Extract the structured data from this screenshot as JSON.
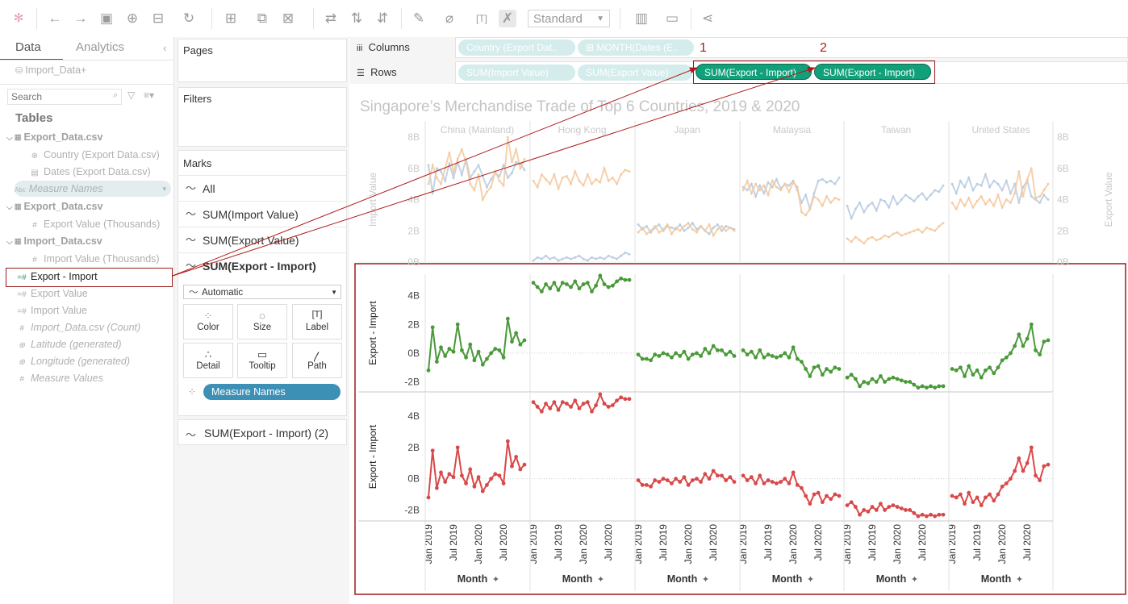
{
  "toolbar": {
    "fit_label": "Standard"
  },
  "data_pane": {
    "tabs": [
      "Data",
      "Analytics"
    ],
    "datasource": "Import_Data+",
    "search_placeholder": "Search",
    "tables_header": "Tables",
    "items": [
      {
        "label": "Export_Data.csv",
        "kind": "table",
        "icon": "table-icon"
      },
      {
        "label": "Country (Export Data.csv)",
        "kind": "dim",
        "icon": "globe-icon"
      },
      {
        "label": "Dates (Export Data.csv)",
        "kind": "dim",
        "icon": "calendar-icon"
      },
      {
        "label": "Measure Names",
        "kind": "pill",
        "icon": "abc-icon"
      },
      {
        "label": "Export_Data.csv",
        "kind": "table",
        "icon": "table-icon"
      },
      {
        "label": "Export Value (Thousands)",
        "kind": "measure",
        "icon": "number-icon"
      },
      {
        "label": "Import_Data.csv",
        "kind": "table",
        "icon": "table-icon"
      },
      {
        "label": "Import Value (Thousands)",
        "kind": "measure",
        "icon": "number-icon"
      },
      {
        "label": "Export - Import",
        "kind": "selected",
        "icon": "calc-icon"
      },
      {
        "label": "Export Value",
        "kind": "measure",
        "icon": "calc-icon"
      },
      {
        "label": "Import Value",
        "kind": "measure",
        "icon": "calc-icon"
      },
      {
        "label": "Import_Data.csv (Count)",
        "kind": "italic",
        "icon": "number-icon"
      },
      {
        "label": "Latitude (generated)",
        "kind": "italic",
        "icon": "globe-icon"
      },
      {
        "label": "Longitude (generated)",
        "kind": "italic",
        "icon": "globe-icon"
      },
      {
        "label": "Measure Values",
        "kind": "italic",
        "icon": "number-icon"
      }
    ]
  },
  "shelves": {
    "pages_label": "Pages",
    "filters_label": "Filters",
    "marks_label": "Marks",
    "marks_rows": [
      "All",
      "SUM(Import Value)",
      "SUM(Export Value)",
      "SUM(Export - Import)"
    ],
    "mark_type": "Automatic",
    "mark_buttons": [
      "Color",
      "Size",
      "Label",
      "Detail",
      "Tooltip",
      "Path"
    ],
    "color_pill": "Measure Names",
    "marks_last_row": "SUM(Export - Import) (2)"
  },
  "columns_shelf": {
    "label": "Columns",
    "pills": [
      "Country (Export Dat..",
      "⊞ MONTH(Dates (E.."
    ]
  },
  "rows_shelf": {
    "label": "Rows",
    "pills": [
      "SUM(Import Value)",
      "SUM(Export Value)",
      "SUM(Export - Import)",
      "SUM(Export - Import)"
    ]
  },
  "annotations": [
    "1",
    "2"
  ],
  "chart_data": {
    "type": "line",
    "title": "Singapore’s Merchandise Trade of Top 6 Countries, 2019 & 2020",
    "categories": [
      "China (Mainland)",
      "Hong Kong",
      "Japan",
      "Malaysia",
      "Taiwan",
      "United States"
    ],
    "x_ticks": [
      "Jan 2019",
      "Jul 2019",
      "Jan 2020",
      "Jul 2020"
    ],
    "x_label": "Month",
    "rows": [
      {
        "ylabel": "Import Value",
        "ylabel_right": "Export Value",
        "ticks": [
          "8B",
          "6B",
          "4B",
          "2B",
          "0B"
        ],
        "ylim": [
          0,
          8
        ]
      },
      {
        "ylabel": "Export - Import",
        "ticks": [
          "4B",
          "2B",
          "0B",
          "-2B"
        ],
        "ylim": [
          -2.7,
          5.5
        ]
      },
      {
        "ylabel": "Export - Import",
        "ticks": [
          "4B",
          "2B",
          "0B",
          "-2B"
        ],
        "ylim": [
          -2.7,
          5.5
        ]
      }
    ],
    "series_colors": {
      "import": "#b8cbe0",
      "export": "#f5c9a0",
      "diff1": "#4a9a3a",
      "diff2": "#d9494a"
    },
    "import_series": [
      [
        6.2,
        4.4,
        6.0,
        5.8,
        5.2,
        6.3,
        5.4,
        6.4,
        5.6,
        6.6,
        5.4,
        5.8,
        6.2,
        5.5,
        4.8,
        5.3,
        5.7,
        5.5,
        6.2,
        5.4,
        5.7,
        6.4,
        6.3,
        5.9
      ],
      [
        0.1,
        0.3,
        0.2,
        0.4,
        0.2,
        0.3,
        0.1,
        0.2,
        0.3,
        0.2,
        0.3,
        0.4,
        0.2,
        0.1,
        0.3,
        0.2,
        0.3,
        0.2,
        0.4,
        0.3,
        0.2,
        0.4,
        0.6,
        0.5
      ],
      [
        2.4,
        2.1,
        2.3,
        1.9,
        2.2,
        2.4,
        2.0,
        2.3,
        2.2,
        2.1,
        2.4,
        2.0,
        2.2,
        2.5,
        2.1,
        2.3,
        2.0,
        1.8,
        2.2,
        2.4,
        2.0,
        2.3,
        2.2,
        2.1
      ],
      [
        4.8,
        4.6,
        5.0,
        4.2,
        4.9,
        4.4,
        5.1,
        4.8,
        5.3,
        4.7,
        5.0,
        4.9,
        5.2,
        4.6,
        3.8,
        4.3,
        3.4,
        4.4,
        5.2,
        5.3,
        5.1,
        5.2,
        5.0,
        5.4
      ],
      [
        3.6,
        2.8,
        3.4,
        3.8,
        3.2,
        3.6,
        3.8,
        3.3,
        4.0,
        3.9,
        3.5,
        4.2,
        3.7,
        4.0,
        4.3,
        4.1,
        3.9,
        4.2,
        4.4,
        4.0,
        4.3,
        4.6,
        4.5,
        4.9
      ],
      [
        5.0,
        4.4,
        5.2,
        4.8,
        5.4,
        4.6,
        5.0,
        4.9,
        5.6,
        4.8,
        5.2,
        5.0,
        4.6,
        5.2,
        4.4,
        5.0,
        3.8,
        4.8,
        5.2,
        4.2,
        4.0,
        3.8,
        4.3,
        4.0
      ]
    ],
    "export_series": [
      [
        5.0,
        6.2,
        5.4,
        5.0,
        6.0,
        7.0,
        5.8,
        6.6,
        7.2,
        6.4,
        5.0,
        4.6,
        5.6,
        4.0,
        4.5,
        4.8,
        5.8,
        5.2,
        4.9,
        8.0,
        6.4,
        7.2,
        6.0,
        6.6
      ],
      [
        5.2,
        4.8,
        5.6,
        5.3,
        5.0,
        5.6,
        4.7,
        5.4,
        5.5,
        5.0,
        5.8,
        5.2,
        4.9,
        5.6,
        5.0,
        5.3,
        5.1,
        6.0,
        5.2,
        5.4,
        5.0,
        5.6,
        5.9,
        5.8
      ],
      [
        1.9,
        2.2,
        1.8,
        2.0,
        2.3,
        1.9,
        2.1,
        2.4,
        1.8,
        2.2,
        2.0,
        2.3,
        2.5,
        2.1,
        1.9,
        2.3,
        2.0,
        2.4,
        1.7,
        2.1,
        2.3,
        2.0,
        2.2,
        2.0
      ],
      [
        4.6,
        5.2,
        4.4,
        5.0,
        4.6,
        4.9,
        4.3,
        5.2,
        4.8,
        4.6,
        5.0,
        4.5,
        5.1,
        4.8,
        3.2,
        3.0,
        3.4,
        4.2,
        4.0,
        3.6,
        4.2,
        3.8,
        4.1,
        4.0
      ],
      [
        1.5,
        1.3,
        1.6,
        1.4,
        1.2,
        1.5,
        1.6,
        1.4,
        1.5,
        1.7,
        1.6,
        1.8,
        1.9,
        1.7,
        1.8,
        1.9,
        2.0,
        2.1,
        1.9,
        2.2,
        2.1,
        2.0,
        2.3,
        2.5
      ],
      [
        3.8,
        3.4,
        4.0,
        3.6,
        4.1,
        3.5,
        3.9,
        4.2,
        3.7,
        4.0,
        3.6,
        4.3,
        3.5,
        4.0,
        3.8,
        4.4,
        5.8,
        4.2,
        5.3,
        6.0,
        4.1,
        4.2,
        4.6,
        5.0
      ]
    ],
    "diff_series": [
      [
        -1.2,
        1.8,
        -0.6,
        0.4,
        -0.2,
        0.3,
        0.1,
        2.0,
        0.2,
        -0.3,
        0.6,
        -0.5,
        0.1,
        -0.8,
        -0.4,
        0.0,
        0.3,
        0.2,
        -0.3,
        2.4,
        0.8,
        1.4,
        0.6,
        0.9
      ],
      [
        4.9,
        4.6,
        4.3,
        4.8,
        4.5,
        4.9,
        4.4,
        4.9,
        4.8,
        4.6,
        5.0,
        4.5,
        4.8,
        4.9,
        4.3,
        4.7,
        5.4,
        4.8,
        4.6,
        4.7,
        5.0,
        5.2,
        5.1,
        5.1
      ],
      [
        -0.1,
        -0.4,
        -0.4,
        -0.5,
        -0.1,
        -0.2,
        0.0,
        -0.1,
        -0.3,
        0.0,
        -0.2,
        0.1,
        -0.4,
        -0.1,
        0.0,
        -0.2,
        0.3,
        0.0,
        0.5,
        0.2,
        0.2,
        -0.1,
        0.1,
        -0.2
      ],
      [
        0.2,
        -0.1,
        0.1,
        -0.3,
        0.2,
        -0.3,
        -0.1,
        -0.2,
        -0.3,
        -0.2,
        0.0,
        -0.3,
        0.4,
        -0.4,
        -0.6,
        -1.1,
        -1.6,
        -1.0,
        -0.9,
        -1.5,
        -1.1,
        -1.3,
        -1.0,
        -1.1
      ],
      [
        -1.7,
        -1.5,
        -1.8,
        -2.3,
        -2.0,
        -2.1,
        -1.8,
        -2.0,
        -1.6,
        -2.0,
        -1.8,
        -1.7,
        -1.8,
        -1.9,
        -2.0,
        -2.0,
        -2.2,
        -2.4,
        -2.3,
        -2.4,
        -2.3,
        -2.4,
        -2.3,
        -2.3
      ],
      [
        -1.1,
        -1.2,
        -1.0,
        -1.6,
        -0.9,
        -1.5,
        -1.2,
        -1.7,
        -1.2,
        -1.0,
        -1.4,
        -1.0,
        -0.5,
        -0.3,
        0.0,
        0.5,
        1.3,
        0.5,
        1.0,
        2.0,
        0.2,
        -0.1,
        0.8,
        0.9
      ]
    ]
  }
}
